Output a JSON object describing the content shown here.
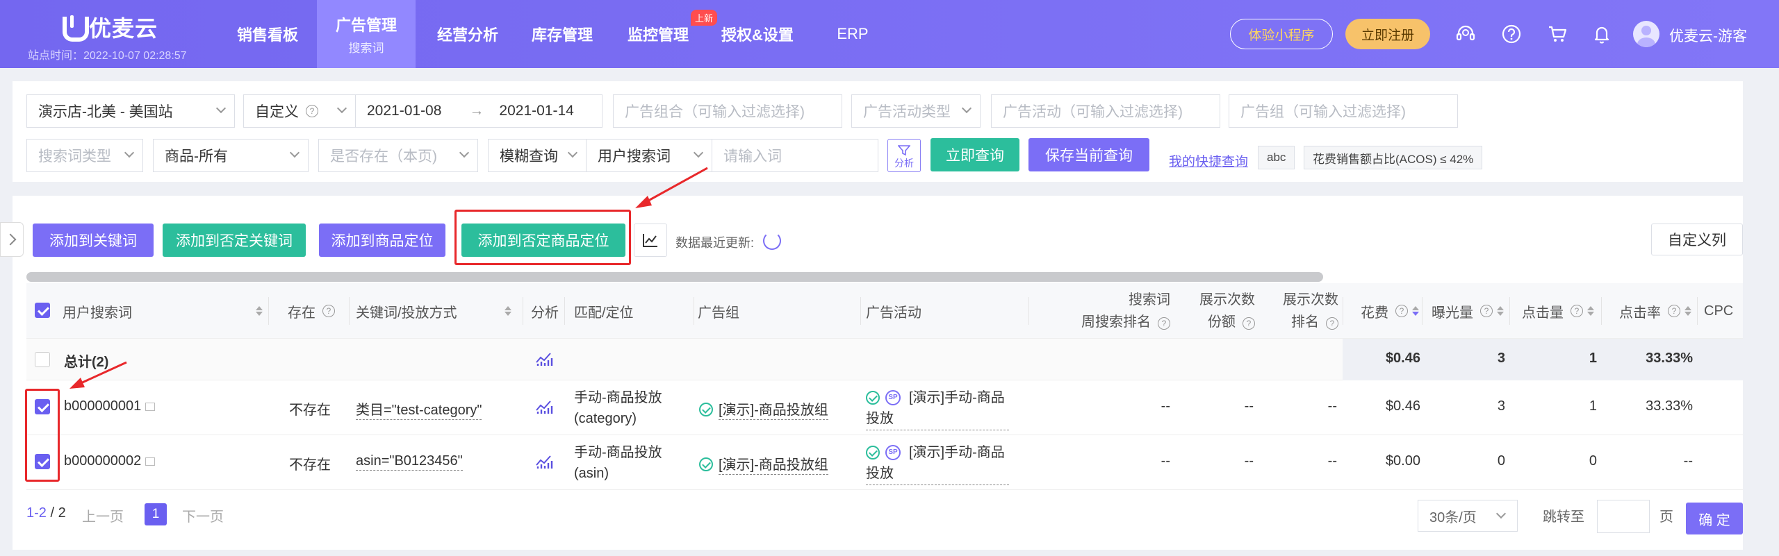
{
  "brand": {
    "name": "优麦云",
    "site_time": "站点时间：2022-10-07 02:28:57"
  },
  "nav": {
    "items": [
      {
        "label": "销售看板"
      },
      {
        "label": "广告管理",
        "sub": "搜索词"
      },
      {
        "label": "经营分析"
      },
      {
        "label": "库存管理"
      },
      {
        "label": "监控管理",
        "badge": "上新"
      },
      {
        "label": "授权&设置"
      },
      {
        "label": "ERP"
      }
    ],
    "trial_label": "体验小程序",
    "register_label": "立即注册",
    "user_name": "优麦云-游客",
    "icons": [
      "headset-icon",
      "help-icon",
      "cart-icon",
      "bell-icon"
    ]
  },
  "filters": {
    "shop": "演示店-北美 - 美国站",
    "date_mode": "自定义",
    "date_start": "2021-01-08",
    "date_end": "2021-01-14",
    "arrow": "→",
    "ad_combo_ph": "广告组合（可输入过滤选择)",
    "campaign_type_ph": "广告活动类型",
    "campaign_ph": "广告活动（可输入过滤选择)",
    "ad_group_ph": "广告组（可输入过滤选择)",
    "search_type_ph": "搜索词类型",
    "product": "商品-所有",
    "exists_ph": "是否存在（本页)",
    "match": "模糊查询",
    "field": "用户搜索词",
    "keyword_ph": "请输入词",
    "analysis_label": "分析",
    "query_label": "立即查询",
    "save_label": "保存当前查询",
    "quick_link": "我的快捷查询",
    "tags": [
      "abc",
      "花费销售额占比(ACOS) ≤ 42%"
    ]
  },
  "toolbar": {
    "add_keyword": "添加到关键词",
    "add_neg_keyword": "添加到否定关键词",
    "add_product_target": "添加到商品定位",
    "add_neg_product_target": "添加到否定商品定位",
    "update_label": "数据最近更新:",
    "custom_cols": "自定义列"
  },
  "table": {
    "headers": {
      "search_term": "用户搜索词",
      "exists": "存在",
      "keyword": "关键词/投放方式",
      "analysis": "分析",
      "match": "匹配/定位",
      "ad_group": "广告组",
      "campaign": "广告活动",
      "rank_a1": "搜索词",
      "rank_a2": "周搜索排名",
      "share_1": "展示次数",
      "share_2": "份额",
      "rank_b1": "展示次数",
      "rank_b2": "排名",
      "spend": "花费",
      "impressions": "曝光量",
      "clicks": "点击量",
      "ctr": "点击率",
      "cpc": "CPC"
    },
    "total": {
      "label": "总计(2)",
      "spend": "$0.46",
      "impressions": "3",
      "clicks": "1",
      "ctr": "33.33%"
    },
    "rows": [
      {
        "term": "b000000001",
        "exists": "不存在",
        "keyword": "类目=\"test-category\"",
        "match_1": "手动-商品投放",
        "match_2": "(category)",
        "ad_group": "[演示]-商品投放组",
        "campaign_1": "[演示]手动-商品",
        "campaign_2": "投放",
        "rank_a": "--",
        "share": "--",
        "rank_b": "--",
        "spend": "$0.46",
        "impressions": "3",
        "clicks": "1",
        "ctr": "33.33%"
      },
      {
        "term": "b000000002",
        "exists": "不存在",
        "keyword": "asin=\"B0123456\"",
        "match_1": "手动-商品投放",
        "match_2": "(asin)",
        "ad_group": "[演示]-商品投放组",
        "campaign_1": "[演示]手动-商品",
        "campaign_2": "投放",
        "rank_a": "--",
        "share": "--",
        "rank_b": "--",
        "spend": "$0.00",
        "impressions": "0",
        "clicks": "0",
        "ctr": "--"
      }
    ]
  },
  "pagination": {
    "range": "1-2",
    "total": "/ 2",
    "prev": "上一页",
    "current": "1",
    "next": "下一页",
    "page_size": "30条/页",
    "jump_label": "跳转至",
    "page_unit": "页",
    "confirm": "确 定"
  },
  "colors": {
    "primary": "#7b6ef6",
    "teal": "#2cbe9c",
    "annotation_red": "#e8282b"
  }
}
